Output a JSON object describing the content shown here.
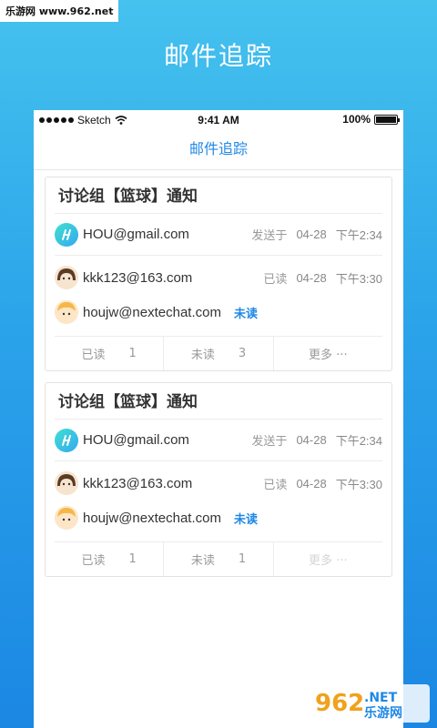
{
  "watermark_top": "乐游网 www.962.net",
  "hero_title": "邮件追踪",
  "statusbar": {
    "carrier": "Sketch",
    "time": "9:41 AM",
    "battery": "100%"
  },
  "navbar": {
    "title": "邮件追踪"
  },
  "cards": [
    {
      "title": "讨论组【篮球】通知",
      "sender": {
        "email": "HOU@gmail.com",
        "status": "发送于",
        "date": "04-28",
        "time": "下午2:34"
      },
      "recipients": [
        {
          "email": "kkk123@163.com",
          "status": "已读",
          "date": "04-28",
          "time": "下午3:30"
        },
        {
          "email": "houjw@nextechat.com",
          "status": "未读"
        }
      ],
      "footer": {
        "read_label": "已读",
        "read_count": "1",
        "unread_label": "未读",
        "unread_count": "3",
        "more_label": "更多 ···"
      }
    },
    {
      "title": "讨论组【篮球】通知",
      "sender": {
        "email": "HOU@gmail.com",
        "status": "发送于",
        "date": "04-28",
        "time": "下午2:34"
      },
      "recipients": [
        {
          "email": "kkk123@163.com",
          "status": "已读",
          "date": "04-28",
          "time": "下午3:30"
        },
        {
          "email": "houjw@nextechat.com",
          "status": "未读"
        }
      ],
      "footer": {
        "read_label": "已读",
        "read_count": "1",
        "unread_label": "未读",
        "unread_count": "1",
        "more_label": "更多 ···"
      }
    }
  ],
  "watermark_bottom": {
    "logo_number": "962",
    "logo_domain": ".NET",
    "logo_text": "乐游网"
  },
  "colors": {
    "accent": "#1e88e5",
    "bg_top": "#45c2ee",
    "bg_bottom": "#1b87e3"
  }
}
